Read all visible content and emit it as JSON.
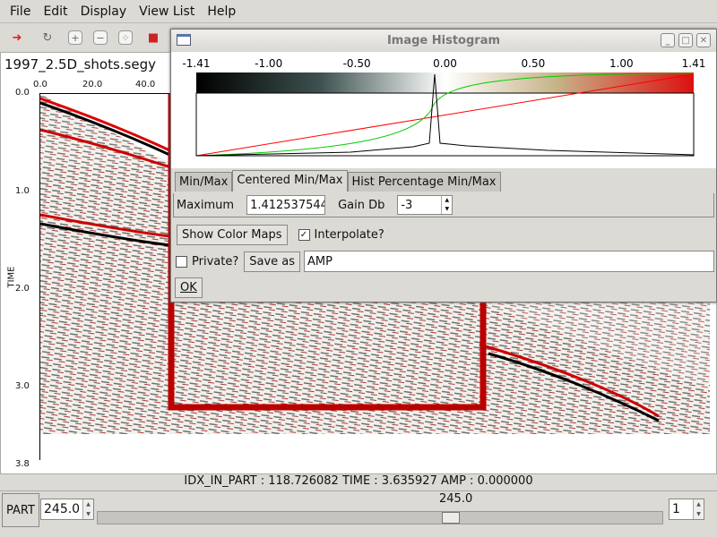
{
  "menu": [
    "File",
    "Edit",
    "Display",
    "View List",
    "Help"
  ],
  "toolbar": [
    "exit-icon",
    "refresh-icon",
    "zoom-in-icon",
    "zoom-out-icon",
    "fit-icon",
    "color-icon"
  ],
  "view": {
    "title": "1997_2.5D_shots.segy",
    "x_ticks": [
      "0.0",
      "20.0",
      "40.0"
    ],
    "y_ticks": [
      "0.0",
      "1.0",
      "2.0",
      "3.0",
      "3.8"
    ],
    "y_label": "TIME"
  },
  "status": "IDX_IN_PART : 118.726082  TIME : 3.635927  AMP : 0.000000",
  "bottom": {
    "part_label": "PART",
    "part_value": "245.0",
    "slider_value": "245.0",
    "slider_fraction": 0.63,
    "step_value": "1"
  },
  "dialog": {
    "title": "Image Histogram",
    "colorbar_ticks": [
      "-1.41",
      "-1.00",
      "-0.50",
      "0.00",
      "0.50",
      "1.00",
      "1.41"
    ],
    "tabs": [
      "Min/Max",
      "Centered Min/Max",
      "Hist Percentage Min/Max"
    ],
    "active_tab": 1,
    "maximum_label": "Maximum",
    "maximum_value": "1.412537544",
    "gain_label": "Gain Db",
    "gain_value": "-3",
    "show_color_maps": "Show Color Maps",
    "interpolate_label": "Interpolate?",
    "interpolate_checked": true,
    "private_label": "Private?",
    "private_checked": false,
    "save_as": "Save as",
    "save_name": "AMP",
    "ok": "OK"
  }
}
